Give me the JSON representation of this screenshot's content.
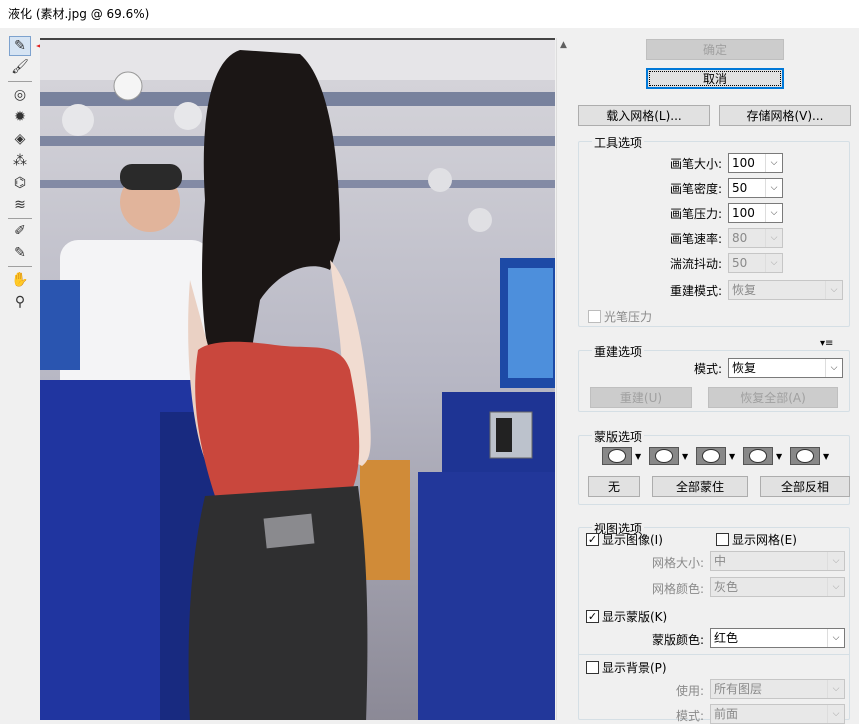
{
  "window": {
    "title": "液化 (素材.jpg @ 69.6%)"
  },
  "tools": [
    {
      "name": "forward-warp-tool",
      "icon": "✎"
    },
    {
      "name": "reconstruct-tool",
      "icon": "🖌"
    },
    {
      "name": "twirl-clockwise-tool",
      "icon": "◎"
    },
    {
      "name": "pucker-tool",
      "icon": "✹"
    },
    {
      "name": "bloat-tool",
      "icon": "◈"
    },
    {
      "name": "push-left-tool",
      "icon": "⁂"
    },
    {
      "name": "mirror-tool",
      "icon": "⌬"
    },
    {
      "name": "turbulence-tool",
      "icon": "≋"
    },
    {
      "name": "freeze-mask-tool",
      "icon": "✐"
    },
    {
      "name": "thaw-mask-tool",
      "icon": "✎"
    },
    {
      "name": "hand-tool",
      "icon": "✋"
    },
    {
      "name": "zoom-tool",
      "icon": "⚲"
    }
  ],
  "buttons": {
    "ok": "确定",
    "cancel": "取消",
    "load_mesh": "载入网格(L)...",
    "save_mesh": "存储网格(V)...",
    "reconstruct": "重建(U)",
    "restore_all": "恢复全部(A)",
    "none": "无",
    "mask_all": "全部蒙住",
    "invert_all": "全部反相"
  },
  "tool_options": {
    "title": "工具选项",
    "brush_size": {
      "label": "画笔大小:",
      "value": "100"
    },
    "brush_density": {
      "label": "画笔密度:",
      "value": "50"
    },
    "brush_pressure": {
      "label": "画笔压力:",
      "value": "100"
    },
    "brush_rate": {
      "label": "画笔速率:",
      "value": "80"
    },
    "turbulent_jitter": {
      "label": "湍流抖动:",
      "value": "50"
    },
    "reconstruct_mode": {
      "label": "重建模式:",
      "value": "恢复"
    },
    "stylus_pressure": "光笔压力"
  },
  "reconstruct_options": {
    "title": "重建选项",
    "mode": {
      "label": "模式:",
      "value": "恢复"
    }
  },
  "mask_options": {
    "title": "蒙版选项"
  },
  "view_options": {
    "title": "视图选项",
    "show_image": "显示图像(I)",
    "show_mesh": "显示网格(E)",
    "mesh_size": {
      "label": "网格大小:",
      "value": "中"
    },
    "mesh_color": {
      "label": "网格颜色:",
      "value": "灰色"
    },
    "show_mask": "显示蒙版(K)",
    "mask_color": {
      "label": "蒙版颜色:",
      "value": "红色"
    },
    "show_backdrop": "显示背景(P)",
    "use": {
      "label": "使用:",
      "value": "所有图层"
    },
    "mode": {
      "label": "模式:",
      "value": "前面"
    }
  },
  "colors": {
    "accent_arrow": "#e02020",
    "shirt": "#c9473d",
    "jeans": "#2f2f30",
    "blue_cabinet": "#22379a"
  }
}
